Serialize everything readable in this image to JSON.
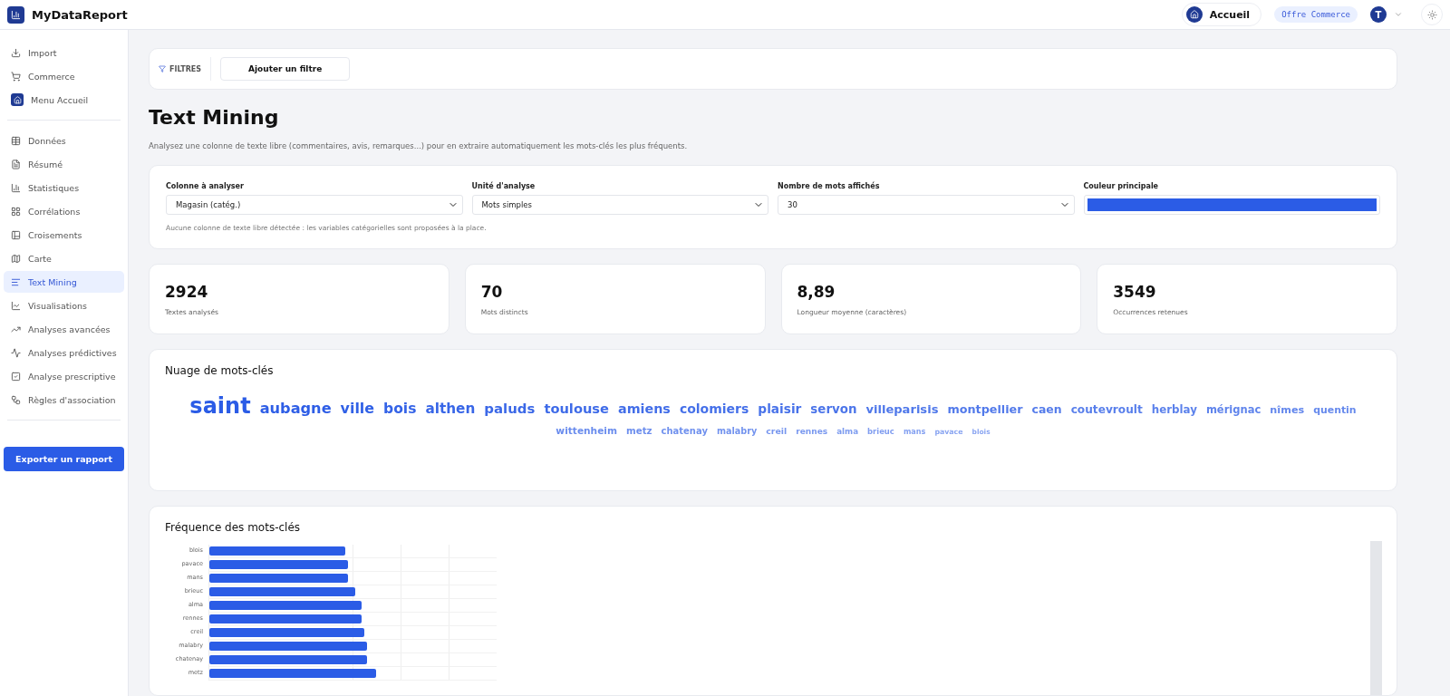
{
  "app": {
    "name": "MyDataReport"
  },
  "header": {
    "home": "Accueil",
    "plan": "Offre Commerce",
    "avatar": "T"
  },
  "sidebar": {
    "top": [
      {
        "label": "Import",
        "selected": false
      },
      {
        "label": "Commerce",
        "selected": false
      },
      {
        "label": "Menu Accueil",
        "selected": false
      }
    ],
    "items": [
      {
        "label": "Données",
        "selected": false
      },
      {
        "label": "Résumé",
        "selected": false
      },
      {
        "label": "Statistiques",
        "selected": false
      },
      {
        "label": "Corrélations",
        "selected": false
      },
      {
        "label": "Croisements",
        "selected": false
      },
      {
        "label": "Carte",
        "selected": false
      },
      {
        "label": "Text Mining",
        "selected": true
      },
      {
        "label": "Visualisations",
        "selected": false
      },
      {
        "label": "Analyses avancées",
        "selected": false
      },
      {
        "label": "Analyses prédictives",
        "selected": false
      },
      {
        "label": "Analyse prescriptive",
        "selected": false
      },
      {
        "label": "Règles d'association",
        "selected": false
      }
    ],
    "export": "Exporter un rapport"
  },
  "filters": {
    "label": "FILTRES",
    "add": "Ajouter un filtre"
  },
  "page": {
    "title": "Text Mining",
    "subtitle": "Analysez une colonne de texte libre (commentaires, avis, remarques...) pour en extraire automatiquement les mots-clés les plus fréquents."
  },
  "settings": {
    "fields": [
      {
        "kind": "select",
        "label": "Colonne à analyser",
        "value": "Magasin (catég.)"
      },
      {
        "kind": "select",
        "label": "Unité d'analyse",
        "value": "Mots simples"
      },
      {
        "kind": "select",
        "label": "Nombre de mots affichés",
        "value": "30"
      },
      {
        "kind": "color",
        "label": "Couleur principale",
        "color": "#2b5ce6"
      }
    ],
    "note": "Aucune colonne de texte libre détectée : les variables catégorielles sont proposées à la place."
  },
  "stats": [
    {
      "value": "2924",
      "label": "Textes analysés"
    },
    {
      "value": "70",
      "label": "Mots distincts"
    },
    {
      "value": "8,89",
      "label": "Longueur moyenne (caractères)"
    },
    {
      "value": "3549",
      "label": "Occurrences retenues"
    }
  ],
  "cloud": {
    "title": "Nuage de mots-clés",
    "words": [
      "saint",
      "aubagne",
      "ville",
      "bois",
      "althen",
      "paluds",
      "toulouse",
      "amiens",
      "colomiers",
      "plaisir",
      "servon",
      "villeparisis",
      "montpellier",
      "caen",
      "coutevroult",
      "herblay",
      "mérignac",
      "nîmes",
      "quentin",
      "wittenheim",
      "metz",
      "chatenay",
      "malabry",
      "creil",
      "rennes",
      "alma",
      "brieuc",
      "mans",
      "pavace",
      "blois"
    ]
  },
  "frequency": {
    "title": "Fréquence des mots-clés",
    "labels": [
      "blois",
      "pavace",
      "mans",
      "brieuc",
      "alma",
      "rennes",
      "creil",
      "malabry",
      "chatenay",
      "metz"
    ]
  }
}
